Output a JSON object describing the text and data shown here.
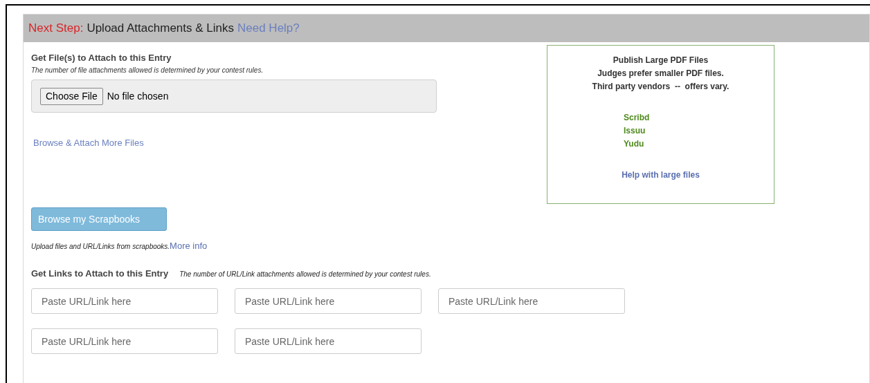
{
  "header": {
    "step_label": "Next Step:",
    "title": "Upload Attachments & Links",
    "help_link": "Need Help?"
  },
  "files": {
    "heading": "Get File(s) to Attach to this Entry",
    "note": "The number of file attachments allowed is determined by your contest rules.",
    "choose_button": "Choose File",
    "file_status": "No file chosen",
    "more_link": "Browse & Attach More Files"
  },
  "pdf_box": {
    "title": "Publish Large PDF Files",
    "lines": [
      "Judges prefer smaller PDF files.",
      "Third party vendors  --  offers vary."
    ],
    "vendors": [
      "Scribd",
      "Issuu",
      "Yudu"
    ],
    "help_link": "Help with large files"
  },
  "scrapbooks": {
    "button": "Browse my Scrapbooks",
    "note": "Upload files and URL/Links from scrapbooks.",
    "more_link": "More info"
  },
  "links": {
    "heading": "Get Links to Attach to this Entry",
    "note": "The number of URL/Link attachments allowed is determined by your contest rules.",
    "fields": [
      {
        "placeholder": "Paste URL/Link here"
      },
      {
        "placeholder": "Paste URL/Link here"
      },
      {
        "placeholder": "Paste URL/Link here"
      },
      {
        "placeholder": "Paste URL/Link here"
      },
      {
        "placeholder": "Paste URL/Link here"
      }
    ]
  }
}
